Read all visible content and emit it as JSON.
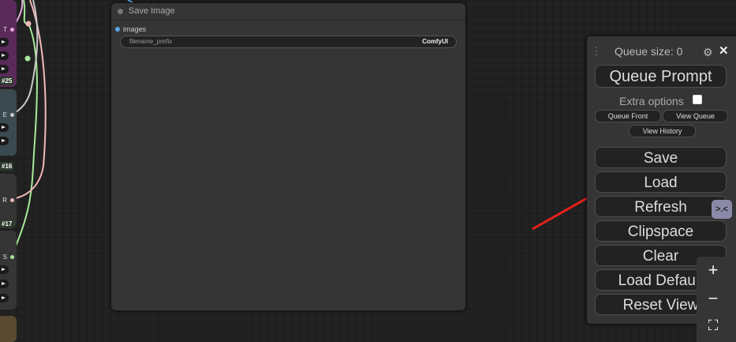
{
  "left_nodes": {
    "node1": {
      "output_label": "T",
      "id": "#25"
    },
    "node2": {
      "output_label": "E",
      "id": "#16"
    },
    "node3": {
      "output_label": "R",
      "id": "#17"
    },
    "node4": {
      "output_label": "S"
    }
  },
  "save_image": {
    "title": "Save Image",
    "input_label": "images",
    "widget_label": "filename_prefix",
    "widget_value": "ComfyUI"
  },
  "queue_panel": {
    "queue_size": "Queue size: 0",
    "queue_prompt": "Queue Prompt",
    "extra_options": "Extra options",
    "queue_front": "Queue Front",
    "view_queue": "View Queue",
    "view_history": "View History",
    "save": "Save",
    "load": "Load",
    "refresh": "Refresh",
    "clipspace": "Clipspace",
    "clear": "Clear",
    "load_default": "Load Default",
    "reset_view": "Reset View"
  },
  "icons": {
    "gear": "gear-icon",
    "close": "close-icon",
    "zoom_in": "plus-icon",
    "zoom_out": "minus-icon",
    "fit": "fit-screen-icon",
    "badge": "badge-icon"
  },
  "annotation": {
    "arrow_color": "#e8201c"
  }
}
